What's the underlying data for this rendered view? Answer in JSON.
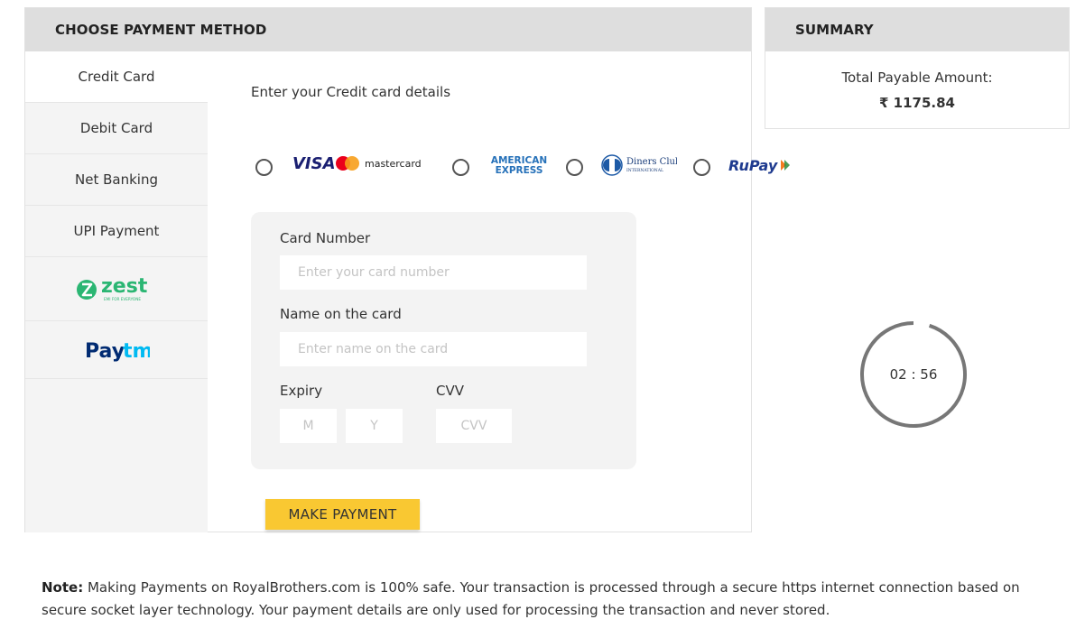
{
  "payment": {
    "header": "CHOOSE PAYMENT METHOD",
    "tabs": [
      "Credit Card",
      "Debit Card",
      "Net Banking",
      "UPI Payment"
    ],
    "wallets": [
      {
        "name": "zest",
        "tagline": "EMI FOR EVERYONE"
      },
      {
        "name": "Paytm"
      }
    ],
    "intro": "Enter your Credit card details",
    "card_brands": {
      "visa": "VISA",
      "mastercard": "mastercard",
      "amex_line1": "AMERICAN",
      "amex_line2": "EXPRESS",
      "diners_line1": "Diners Club",
      "diners_line2": "INTERNATIONAL",
      "rupay": "RuPay"
    },
    "form": {
      "card_number_label": "Card Number",
      "card_number_placeholder": "Enter your card number",
      "name_label": "Name on the card",
      "name_placeholder": "Enter name on the card",
      "expiry_label": "Expiry",
      "month_placeholder": "M",
      "year_placeholder": "Y",
      "cvv_label": "CVV",
      "cvv_placeholder": "CVV"
    },
    "button": "MAKE PAYMENT"
  },
  "summary": {
    "header": "SUMMARY",
    "total_label": "Total Payable Amount:",
    "total_amount": "₹ 1175.84"
  },
  "timer": {
    "text": "02 : 56",
    "fraction": 0.95
  },
  "note": {
    "prefix": "Note:",
    "text": "Making Payments on RoyalBrothers.com is 100% safe. Your transaction is processed through a secure https internet connection based on secure socket layer technology. Your payment details are only used for processing the transaction and never stored."
  },
  "colors": {
    "header_bg": "#dedede",
    "button_bg": "#f9c832",
    "visa_blue": "#1a1f71",
    "amex_blue": "#2671b9",
    "rupay_blue": "#1f3b8f",
    "rupay_orange": "#f47b20",
    "zest_green": "#2bb673",
    "paytm_blue": "#00baf2",
    "paytm_navy": "#012b72"
  }
}
